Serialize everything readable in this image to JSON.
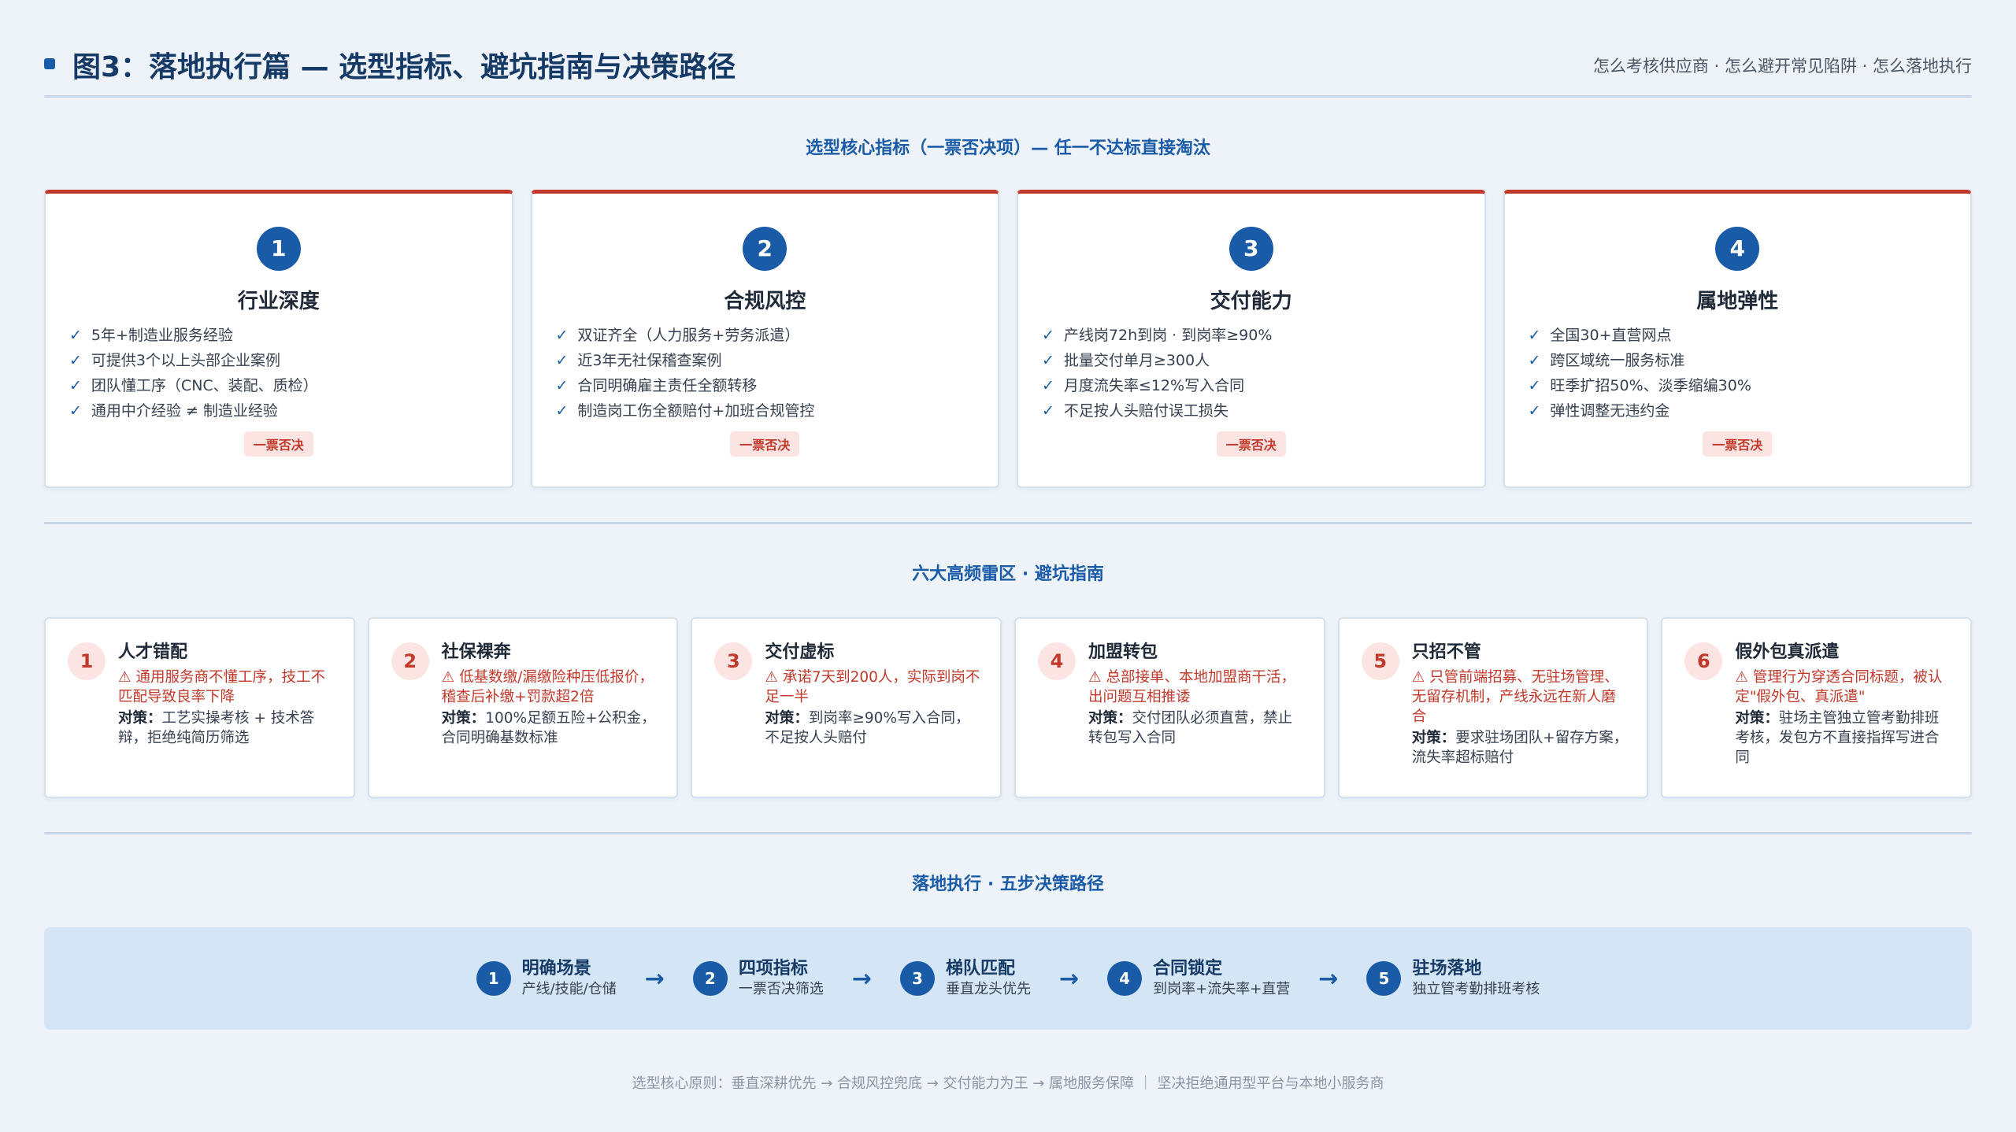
{
  "header": {
    "title": "图3：落地执行篇 — 选型指标、避坑指南与决策路径",
    "subtitle": "怎么考核供应商 · 怎么避开常见陷阱 · 怎么落地执行"
  },
  "criteria_section": {
    "title": "选型核心指标（一票否决项）— 任一不达标直接淘汰",
    "cards": [
      {
        "num": "1",
        "name": "行业深度",
        "items": [
          "5年+制造业服务经验",
          "可提供3个以上头部企业案例",
          "团队懂工序（CNC、装配、质检）",
          "通用中介经验 ≠ 制造业经验"
        ],
        "veto": "一票否决"
      },
      {
        "num": "2",
        "name": "合规风控",
        "items": [
          "双证齐全（人力服务+劳务派遣）",
          "近3年无社保稽查案例",
          "合同明确雇主责任全额转移",
          "制造岗工伤全额赔付+加班合规管控"
        ],
        "veto": "一票否决"
      },
      {
        "num": "3",
        "name": "交付能力",
        "items": [
          "产线岗72h到岗 · 到岗率≥90%",
          "批量交付单月≥300人",
          "月度流失率≤12%写入合同",
          "不足按人头赔付误工损失"
        ],
        "veto": "一票否决"
      },
      {
        "num": "4",
        "name": "属地弹性",
        "items": [
          "全国30+直营网点",
          "跨区域统一服务标准",
          "旺季扩招50%、淡季缩编30%",
          "弹性调整无违约金"
        ],
        "veto": "一票否决"
      }
    ],
    "check_mark": "✓"
  },
  "pitfalls_section": {
    "title": "六大高频雷区 · 避坑指南",
    "fix_label": "对策：",
    "warn_mark": "⚠",
    "items": [
      {
        "num": "1",
        "name": "人才错配",
        "warning": "通用服务商不懂工序，技工不匹配导致良率下降",
        "fix": "工艺实操考核 + 技术答辩，拒绝纯简历筛选"
      },
      {
        "num": "2",
        "name": "社保裸奔",
        "warning": "低基数缴/漏缴险种压低报价，稽查后补缴+罚款超2倍",
        "fix": "100%足额五险+公积金，合同明确基数标准"
      },
      {
        "num": "3",
        "name": "交付虚标",
        "warning": "承诺7天到200人，实际到岗不足一半",
        "fix": "到岗率≥90%写入合同，不足按人头赔付"
      },
      {
        "num": "4",
        "name": "加盟转包",
        "warning": "总部接单、本地加盟商干活，出问题互相推诿",
        "fix": "交付团队必须直营，禁止转包写入合同"
      },
      {
        "num": "5",
        "name": "只招不管",
        "warning": "只管前端招募、无驻场管理、无留存机制，产线永远在新人磨合",
        "fix": "要求驻场团队+留存方案，流失率超标赔付"
      },
      {
        "num": "6",
        "name": "假外包真派遣",
        "warning": "管理行为穿透合同标题，被认定\"假外包、真派遣\"",
        "fix": "驻场主管独立管考勤排班考核，发包方不直接指挥写进合同"
      }
    ]
  },
  "steps_section": {
    "title": "落地执行 · 五步决策路径",
    "arrow": "→",
    "steps": [
      {
        "num": "1",
        "name": "明确场景",
        "desc": "产线/技能/仓储"
      },
      {
        "num": "2",
        "name": "四项指标",
        "desc": "一票否决筛选"
      },
      {
        "num": "3",
        "name": "梯队匹配",
        "desc": "垂直龙头优先"
      },
      {
        "num": "4",
        "name": "合同锁定",
        "desc": "到岗率+流失率+直营"
      },
      {
        "num": "5",
        "name": "驻场落地",
        "desc": "独立管考勤排班考核"
      }
    ]
  },
  "footer": {
    "text": "选型核心原则：垂直深耕优先 → 合规风控兜底 → 交付能力为王 → 属地服务保障 ｜ 坚决拒绝通用型平台与本地小服务商"
  },
  "colors": {
    "primary": "#1a5ba8",
    "danger": "#c0392b",
    "background": "#eef3fa"
  }
}
